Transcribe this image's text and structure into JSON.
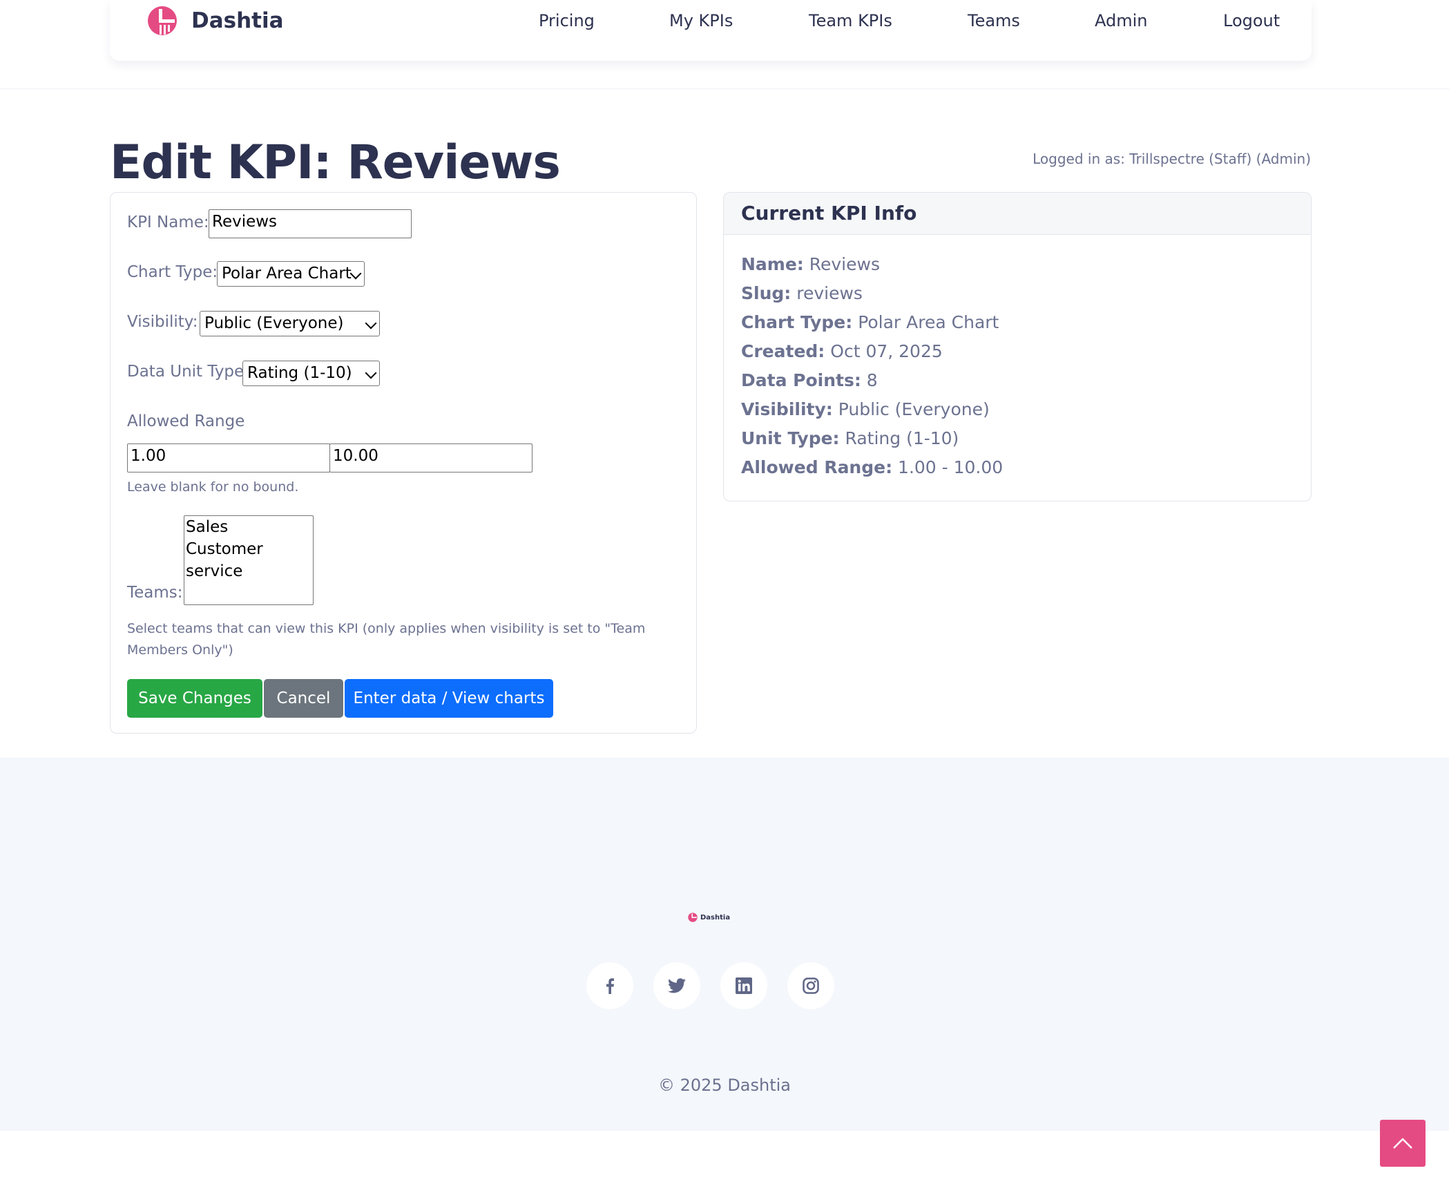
{
  "brand": {
    "name": "Dashtia",
    "color": "#e54b83"
  },
  "nav": {
    "items": [
      "Pricing",
      "My KPIs",
      "Team KPIs",
      "Teams",
      "Admin",
      "Logout"
    ]
  },
  "page": {
    "title": "Edit KPI: Reviews",
    "logged_in": "Logged in as: Trillspectre (Staff) (Admin)"
  },
  "form": {
    "kpi_name_label": "KPI Name:",
    "kpi_name_value": "Reviews",
    "chart_type_label": "Chart Type:",
    "chart_type_value": "Polar Area Chart",
    "visibility_label": "Visibility:",
    "visibility_value": "Public (Everyone)",
    "unit_type_label": "Data Unit Type",
    "unit_type_value": "Rating (1-10)",
    "range_label": "Allowed Range",
    "range_min": "1.00",
    "range_max": "10.00",
    "range_help": "Leave blank for no bound.",
    "teams_label": "Teams:",
    "teams_options": [
      "Sales",
      "Customer service"
    ],
    "teams_help": "Select teams that can view this KPI (only applies when visibility is set to \"Team Members Only\")",
    "save_label": "Save Changes",
    "cancel_label": "Cancel",
    "view_label": "Enter data / View charts"
  },
  "info": {
    "title": "Current KPI Info",
    "rows": [
      {
        "key": "Name:",
        "value": "Reviews"
      },
      {
        "key": "Slug:",
        "value": "reviews"
      },
      {
        "key": "Chart Type:",
        "value": "Polar Area Chart"
      },
      {
        "key": "Created:",
        "value": "Oct 07, 2025"
      },
      {
        "key": "Data Points:",
        "value": "8"
      },
      {
        "key": "Visibility:",
        "value": "Public (Everyone)"
      },
      {
        "key": "Unit Type:",
        "value": "Rating (1-10)"
      },
      {
        "key": "Allowed Range:",
        "value": "1.00 - 10.00"
      }
    ]
  },
  "footer": {
    "brand": "Dashtia",
    "social": [
      "facebook-icon",
      "twitter-icon",
      "linkedin-icon",
      "instagram-icon"
    ],
    "copyright": "© 2025 Dashtia"
  },
  "colors": {
    "save": "#28a745",
    "cancel": "#6c757d",
    "primary": "#0d6efd",
    "accent": "#e54b83"
  }
}
